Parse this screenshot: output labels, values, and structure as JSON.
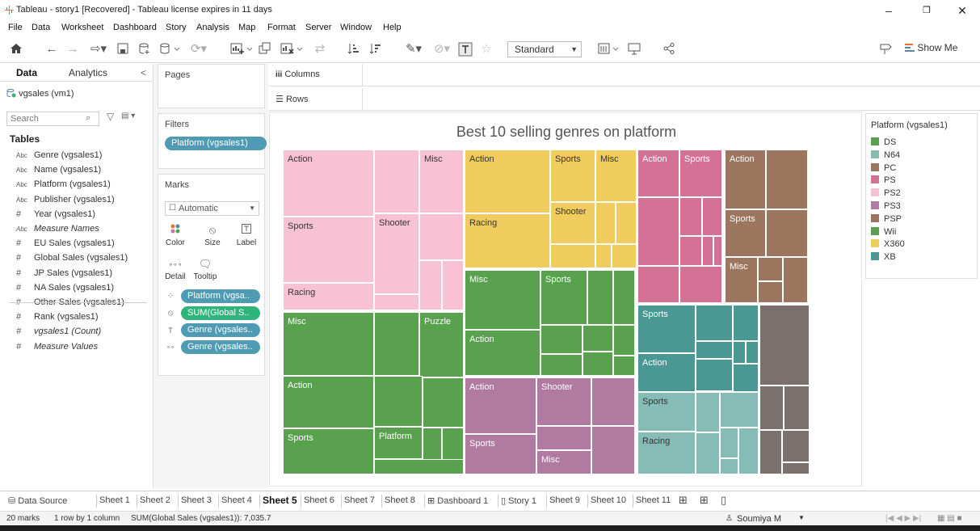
{
  "window": {
    "title": "Tableau - story1 [Recovered] - Tableau license expires in 11 days",
    "minimize": "–",
    "maximize": "❐",
    "close": "✕"
  },
  "menu": [
    "File",
    "Data",
    "Worksheet",
    "Dashboard",
    "Story",
    "Analysis",
    "Map",
    "Format",
    "Server",
    "Window",
    "Help"
  ],
  "toolbar": {
    "fit_select": "Standard",
    "show_me": "Show Me"
  },
  "data_pane": {
    "tabs": [
      "Data",
      "Analytics"
    ],
    "datasource": "vgsales (vm1)",
    "search_placeholder": "Search",
    "tables_heading": "Tables",
    "fields": [
      {
        "type": "Abc",
        "name": "Genre (vgsales1)",
        "italic": false
      },
      {
        "type": "Abc",
        "name": "Name (vgsales1)",
        "italic": false
      },
      {
        "type": "Abc",
        "name": "Platform (vgsales1)",
        "italic": false
      },
      {
        "type": "Abc",
        "name": "Publisher (vgsales1)",
        "italic": false
      },
      {
        "type": "#",
        "name": "Year (vgsales1)",
        "italic": false
      },
      {
        "type": "Abc",
        "name": "Measure Names",
        "italic": true
      },
      {
        "type": "#",
        "name": "EU Sales (vgsales1)",
        "italic": false
      },
      {
        "type": "#",
        "name": "Global Sales (vgsales1)",
        "italic": false
      },
      {
        "type": "#",
        "name": "JP Sales (vgsales1)",
        "italic": false
      },
      {
        "type": "#",
        "name": "NA Sales (vgsales1)",
        "italic": false
      },
      {
        "type": "#",
        "name": "Other Sales (vgsales1)",
        "italic": false
      },
      {
        "type": "#",
        "name": "Rank (vgsales1)",
        "italic": false
      },
      {
        "type": "#",
        "name": "vgsales1 (Count)",
        "italic": true
      },
      {
        "type": "#",
        "name": "Measure Values",
        "italic": true
      }
    ]
  },
  "cards": {
    "pages_title": "Pages",
    "filters_title": "Filters",
    "filter_pill": "Platform (vgsales1)",
    "marks_title": "Marks",
    "marks_type": "Automatic",
    "mark_buttons": [
      "Color",
      "Size",
      "Label",
      "Detail",
      "Tooltip"
    ],
    "mark_pills": [
      "Platform (vgsa..",
      "SUM(Global S..",
      "Genre (vgsales..",
      "Genre (vgsales.."
    ]
  },
  "shelves": {
    "columns": "Columns",
    "rows": "Rows"
  },
  "colors": {
    "DS": "#59a14f",
    "N64": "#86bcb6",
    "PC": "#9c755f",
    "PS": "#d37295",
    "PS2": "#f8c1d4",
    "PS3": "#b07aa1",
    "PSP": "#9d7660",
    "Wii": "#59a14f",
    "X360": "#f0cc5f",
    "XB": "#499894",
    "Grey": "#7a716f"
  },
  "chart_data": {
    "type": "treemap",
    "title": "Best 10 selling genres on platform",
    "legend_title": "Platform (vgsales1)",
    "legend_placement": "right",
    "legend": [
      "DS",
      "N64",
      "PC",
      "PS",
      "PS2",
      "PS3",
      "PSP",
      "Wii",
      "X360",
      "XB"
    ],
    "labels": {
      "PS2": [
        "Action",
        "Misc",
        "Sports",
        "Shooter",
        "Racing"
      ],
      "X360": [
        "Action",
        "Sports",
        "Misc",
        "Racing",
        "Shooter"
      ],
      "PS": [
        "Action",
        "Sports"
      ],
      "PSP": [
        "Action",
        "Sports",
        "Misc"
      ],
      "Wii": [
        "Misc",
        "Puzzle",
        "Action",
        "Sports",
        "Platform"
      ],
      "DS": [
        "Misc",
        "Sports",
        "Action"
      ],
      "PS3": [
        "Action",
        "Shooter",
        "Sports",
        "Misc"
      ],
      "XB": [
        "Sports",
        "Action"
      ],
      "N64": [
        "Sports",
        "Racing"
      ]
    }
  },
  "sheets": [
    "Data Source",
    "Sheet 1",
    "Sheet 2",
    "Sheet 3",
    "Sheet 4",
    "Sheet 5",
    "Sheet 6",
    "Sheet 7",
    "Sheet 8",
    "Dashboard 1",
    "Story 1",
    "Sheet 9",
    "Sheet 10",
    "Sheet 11"
  ],
  "active_sheet": "Sheet 5",
  "status": {
    "marks": "20 marks",
    "rows_cols": "1 row by 1 column",
    "sum": "SUM(Global Sales (vgsales1)): 7,035.7",
    "user": "Soumiya M"
  }
}
